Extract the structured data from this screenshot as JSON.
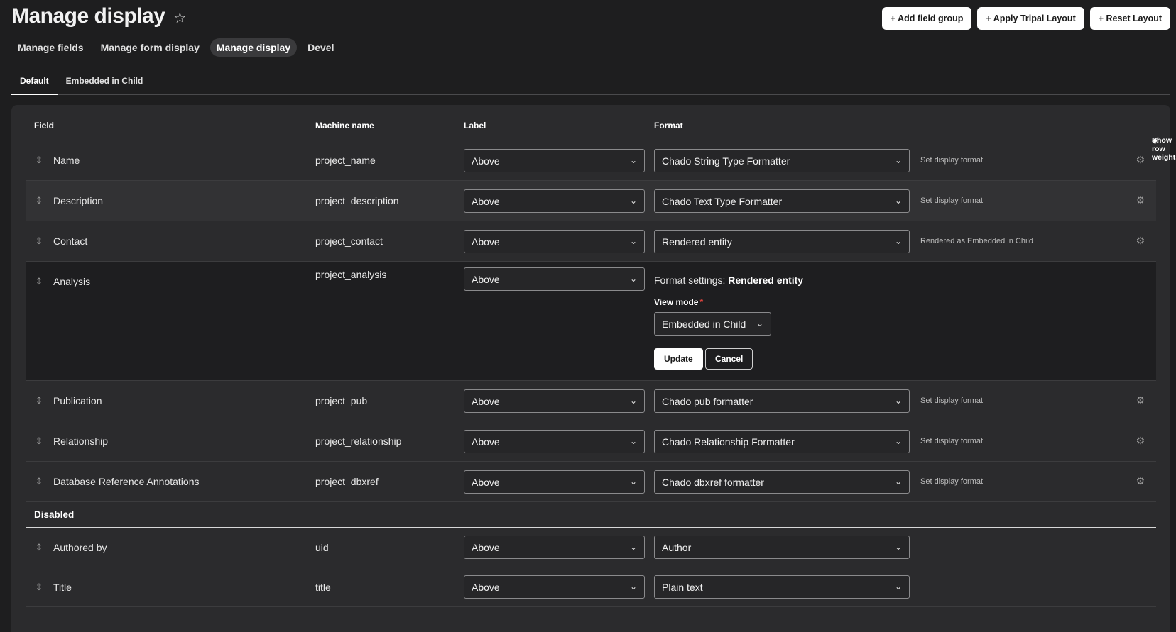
{
  "header": {
    "title": "Manage display",
    "actions": [
      "+ Add field group",
      "+ Apply Tripal Layout",
      "+ Reset Layout"
    ]
  },
  "primary_tabs": [
    "Manage fields",
    "Manage form display",
    "Manage display",
    "Devel"
  ],
  "secondary_tabs": [
    "Default",
    "Embedded in Child"
  ],
  "table": {
    "headers": {
      "field": "Field",
      "machine": "Machine name",
      "label": "Label",
      "format": "Format",
      "show_weights": "Show row weights"
    },
    "rows": [
      {
        "name": "Name",
        "machine": "project_name",
        "label": "Above",
        "format": "Chado String Type Formatter",
        "summary": "Set display format"
      },
      {
        "name": "Description",
        "machine": "project_description",
        "label": "Above",
        "format": "Chado Text Type Formatter",
        "summary": "Set display format"
      },
      {
        "name": "Contact",
        "machine": "project_contact",
        "label": "Above",
        "format": "Rendered entity",
        "summary": "Rendered as Embedded in Child"
      },
      {
        "name": "Analysis",
        "machine": "project_analysis",
        "label": "Above"
      },
      {
        "name": "Publication",
        "machine": "project_pub",
        "label": "Above",
        "format": "Chado pub formatter",
        "summary": "Set display format"
      },
      {
        "name": "Relationship",
        "machine": "project_relationship",
        "label": "Above",
        "format": "Chado Relationship Formatter",
        "summary": "Set display format"
      },
      {
        "name": "Database Reference Annotations",
        "machine": "project_dbxref",
        "label": "Above",
        "format": "Chado dbxref formatter",
        "summary": "Set display format"
      }
    ],
    "format_settings": {
      "prefix": "Format settings:",
      "formatter": "Rendered entity",
      "view_mode_label": "View mode",
      "view_mode_value": "Embedded in Child",
      "update": "Update",
      "cancel": "Cancel"
    },
    "disabled_label": "Disabled",
    "disabled_rows": [
      {
        "name": "Authored by",
        "machine": "uid",
        "label": "Above",
        "format": "Author"
      },
      {
        "name": "Title",
        "machine": "title",
        "label": "Above",
        "format": "Plain text"
      }
    ]
  }
}
